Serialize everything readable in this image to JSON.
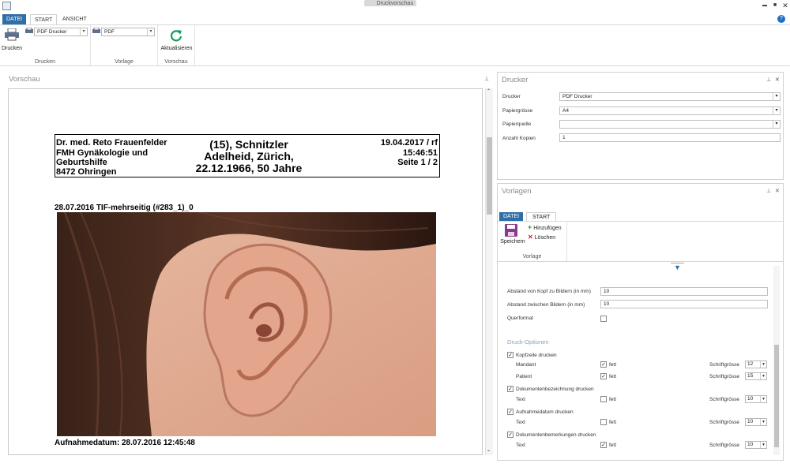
{
  "window": {
    "title": "Druckvorschau",
    "minimize": "▬",
    "maximize": "■",
    "close": "✕"
  },
  "ribbon_tabs": {
    "datei": "DATEI",
    "start": "START",
    "ansicht": "ANSICHT",
    "help": "?"
  },
  "ribbon": {
    "drucken_button": "Drucken",
    "printer_select": "PDF Drucker",
    "template_select": "PDF",
    "aktualisieren_button": "Aktualisieren",
    "group_drucken": "Drucken",
    "group_vorlage": "Vorlage",
    "group_vorschau": "Vorschau"
  },
  "preview": {
    "title": "Vorschau",
    "pin": "📌",
    "header": {
      "doctor_line1": "Dr. med. Reto Frauenfelder",
      "doctor_line2": "FMH Gynäkologie und",
      "doctor_line3": "Geburtshilfe",
      "doctor_line4": "8472 Ohringen",
      "patient_line1": "(15), Schnitzler",
      "patient_line2": "Adelheid, Zürich,",
      "patient_line3": "22.12.1966, 50 Jahre",
      "date_line": "19.04.2017 / rf",
      "time_line": "15:46:51",
      "page_line": "Seite 1 / 2"
    },
    "document_label": "28.07.2016  TIF-mehrseitig (#283_1)_0",
    "footer_label": "Aufnahmedatum: 28.07.2016 12:45:48"
  },
  "drucker_panel": {
    "title": "Drucker",
    "rows": [
      {
        "label": "Drucker",
        "value": "PDF Drucker"
      },
      {
        "label": "Papiergrösse",
        "value": "A4"
      },
      {
        "label": "Papierquelle",
        "value": ""
      },
      {
        "label": "Anzahl Kopien",
        "value": "1"
      }
    ]
  },
  "vorlagen_panel": {
    "title": "Vorlagen",
    "tab_datei": "DATEI",
    "tab_start": "START",
    "speichern": "Speichern",
    "hinzufuegen": "Hinzufügen",
    "loeschen": "Löschen",
    "group_vorlage": "Vorlage",
    "abstand_kopf_label": "Abstand von Kopf zu Bildern (in mm)",
    "abstand_kopf_value": "10",
    "abstand_bilder_label": "Abstand zwischen Bildern (in mm)",
    "abstand_bilder_value": "10",
    "querformat_label": "Querformat",
    "druck_optionen": "Druck-Optionen",
    "kopfzeile": "Kopfzeile drucken",
    "mandant": "Mandant",
    "patient": "Patient",
    "dokbez": "Dokumentenbezeichnung drucken",
    "aufnahmedatum": "Aufnahmedatum drucken",
    "dokbem": "Dokumentenbemerkungen drucken",
    "text": "Text",
    "fett": "fett",
    "schriftgroesse": "Schriftgrösse",
    "size_mandant": "12",
    "size_patient": "15",
    "size_dokbez": "10",
    "size_aufnahme": "10",
    "size_dokbem": "10"
  }
}
